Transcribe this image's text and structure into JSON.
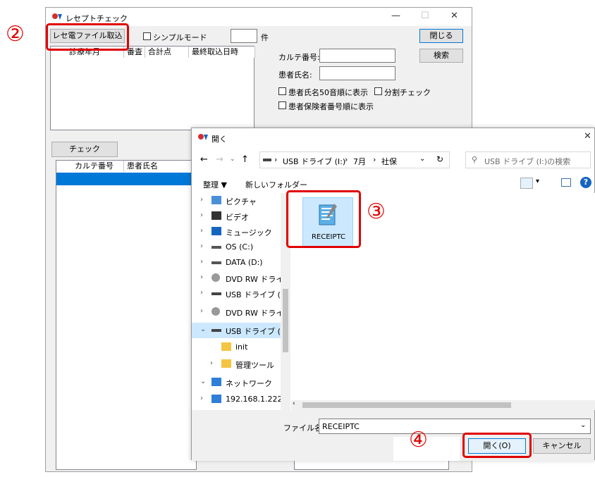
{
  "main_window": {
    "title": "レセプトチェック",
    "import_button": "レセ電ファイル取込",
    "simple_mode_label": "シンプルモード",
    "count_unit": "件",
    "close_button": "閉じる",
    "search_button": "検索",
    "history_columns": [
      "診療年月",
      "番査",
      "合計点",
      "最終取込日時"
    ],
    "chart_no_label": "カルテ番号:",
    "patient_name_label": "患者氏名:",
    "sort_50on_label": "患者氏名50音順に表示",
    "split_check_label": "分割チェック",
    "sort_insurer_label": "患者保険者番号順に表示",
    "check_button": "チェック",
    "patient_columns": [
      "カルテ番号",
      "患者氏名"
    ]
  },
  "dialog": {
    "title": "開く",
    "breadcrumb": [
      "USB ドライブ (I:)",
      "7月",
      "社保"
    ],
    "search_placeholder": "USB ドライブ (I:)の検索",
    "organize_label": "整理 ▼",
    "new_folder_label": "新しいフォルダー",
    "tree": [
      {
        "label": "ピクチャ",
        "icon": "pictures-icon",
        "chev": "›"
      },
      {
        "label": "ビデオ",
        "icon": "video-icon",
        "chev": "›"
      },
      {
        "label": "ミュージック",
        "icon": "music-icon",
        "chev": "›"
      },
      {
        "label": "OS (C:)",
        "icon": "drive-icon",
        "chev": "›"
      },
      {
        "label": "DATA (D:)",
        "icon": "drive-icon",
        "chev": "›"
      },
      {
        "label": "DVD RW ドライブ (",
        "icon": "dvd-icon",
        "chev": "›"
      },
      {
        "label": "USB ドライブ (I:)",
        "icon": "usb-icon",
        "chev": "›"
      },
      {
        "label": "DVD RW ドライブ (E",
        "icon": "dvd-icon",
        "chev": "›"
      },
      {
        "label": "USB ドライブ (I:)",
        "icon": "usb-icon",
        "chev": "⌄",
        "selected": true
      },
      {
        "label": "init",
        "icon": "folder-icon",
        "chev": ""
      },
      {
        "label": "管理ツール",
        "icon": "folder-icon",
        "chev": "›"
      },
      {
        "label": "ネットワーク",
        "icon": "network-icon",
        "chev": "⌄"
      },
      {
        "label": "192.168.1.222",
        "icon": "computer-icon",
        "chev": "›"
      }
    ],
    "file_name": "RECEIPTC",
    "filename_label": "ファイル名(N):",
    "filename_value": "RECEIPTC",
    "open_button": "開く(O)",
    "cancel_button": "キャンセル"
  },
  "callouts": {
    "step2": "②",
    "step3": "③",
    "step4": "④"
  },
  "colors": {
    "accent": "#0078d7",
    "callout_red": "#e00000",
    "selection": "#cce8ff"
  }
}
